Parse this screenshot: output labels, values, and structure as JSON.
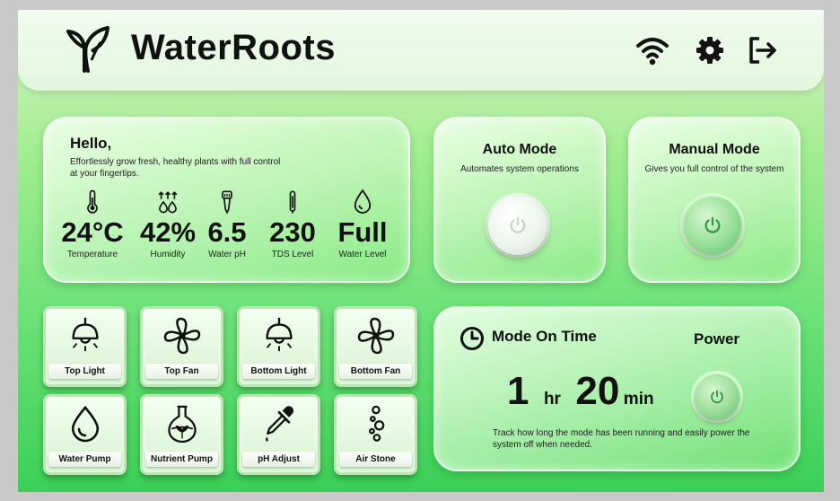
{
  "app": {
    "title": "WaterRoots",
    "accent": "#3bcf57"
  },
  "header": {
    "icons": [
      "leaf-logo-icon",
      "wifi-icon",
      "gear-icon",
      "logout-icon"
    ]
  },
  "welcome": {
    "greeting": "Hello,",
    "subtitle": "Effortlessly grow fresh, healthy plants with full control at your fingertips."
  },
  "metrics": [
    {
      "icon": "thermometer-icon",
      "value": "24°C",
      "label": "Temperature"
    },
    {
      "icon": "humidity-icon",
      "value": "42%",
      "label": "Humidity"
    },
    {
      "icon": "ph-probe-icon",
      "value": "6.5",
      "label": "Water pH"
    },
    {
      "icon": "tds-probe-icon",
      "value": "230",
      "label": "TDS Level"
    },
    {
      "icon": "water-drop-icon",
      "value": "Full",
      "label": "Water Level"
    }
  ],
  "modes": {
    "auto": {
      "title": "Auto Mode",
      "desc": "Automates system operations",
      "state": "off"
    },
    "manual": {
      "title": "Manual Mode",
      "desc": "Gives you full control of the system",
      "state": "on"
    }
  },
  "controls": [
    {
      "icon": "ceiling-light-icon",
      "label": "Top Light"
    },
    {
      "icon": "fan-icon",
      "label": "Top Fan"
    },
    {
      "icon": "ceiling-light-icon",
      "label": "Bottom Light"
    },
    {
      "icon": "fan-icon",
      "label": "Bottom Fan"
    },
    {
      "icon": "water-drop-icon",
      "label": "Water Pump"
    },
    {
      "icon": "flask-icon",
      "label": "Nutrient Pump"
    },
    {
      "icon": "dropper-icon",
      "label": "pH Adjust"
    },
    {
      "icon": "bubbles-icon",
      "label": "Air Stone"
    }
  ],
  "mode_time": {
    "title": "Mode On Time",
    "hours": "1",
    "hours_unit": "hr",
    "minutes": "20",
    "minutes_unit": "min",
    "power_label": "Power",
    "note": "Track how long the mode has been running and easily power the system off when needed."
  }
}
